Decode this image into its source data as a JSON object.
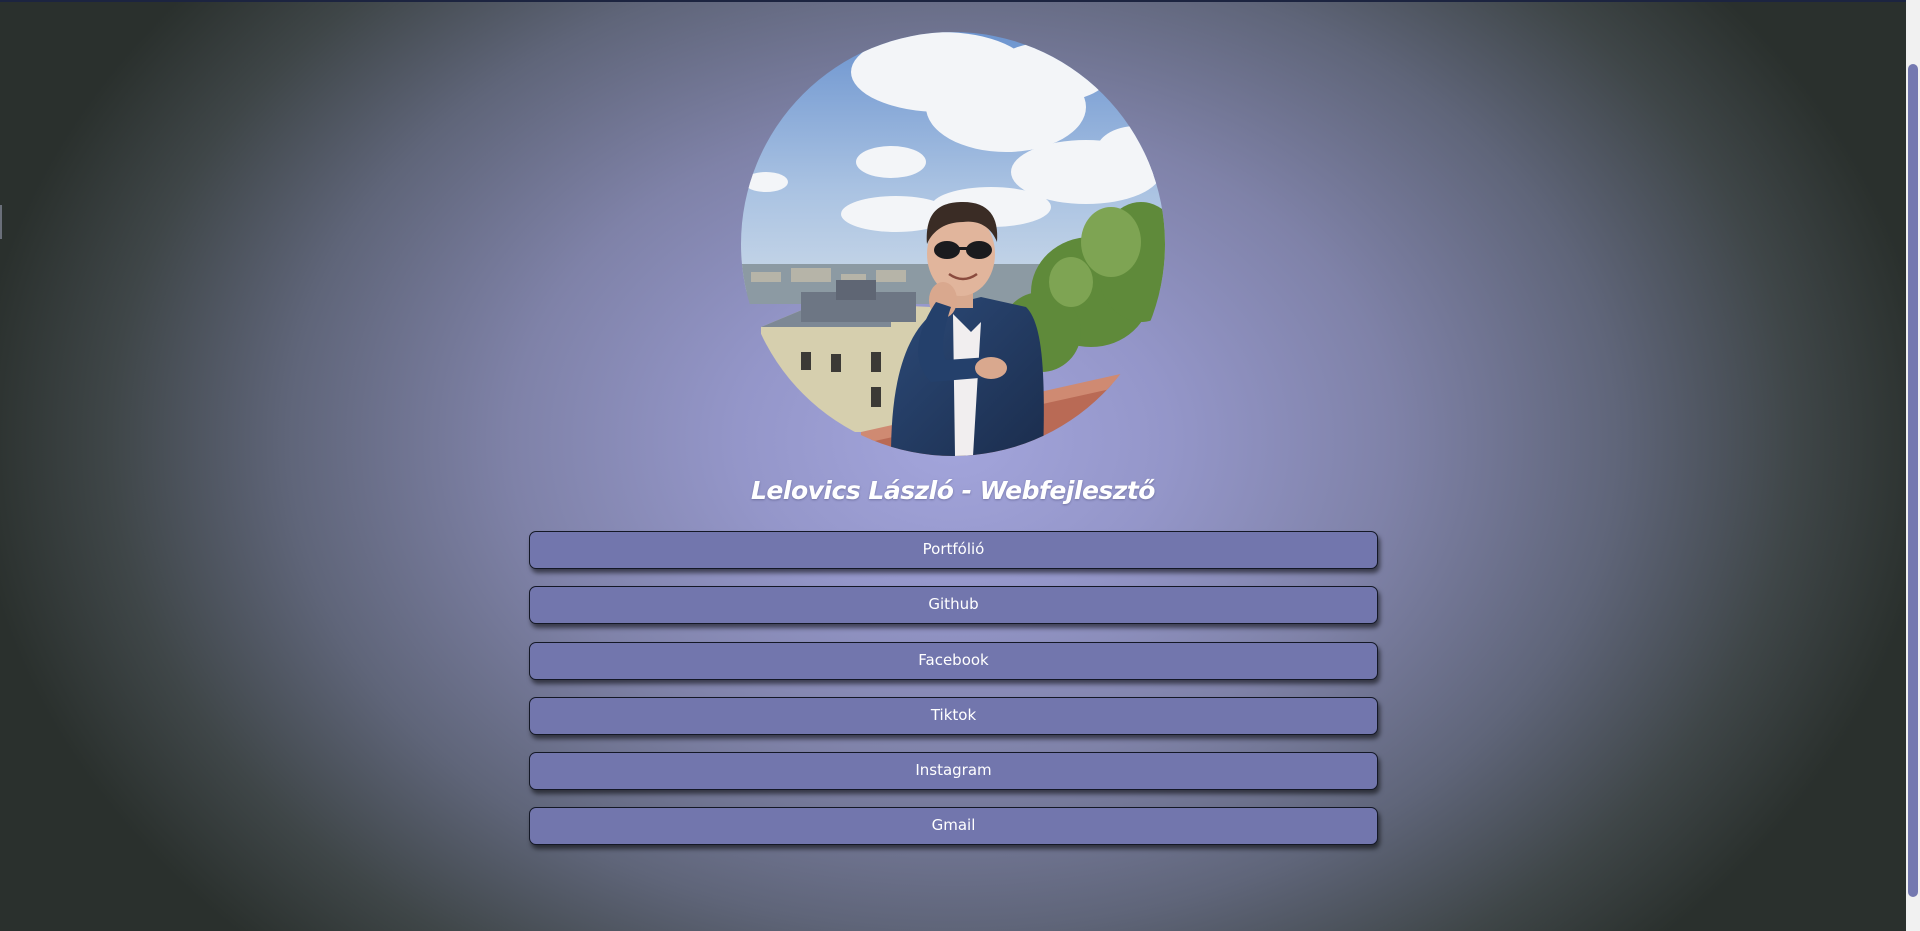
{
  "profile": {
    "photo_alt": "Lelovics László",
    "title": "Lelovics László - Webfejlesztő"
  },
  "links": [
    {
      "label": "Portfólió"
    },
    {
      "label": "Github"
    },
    {
      "label": "Facebook"
    },
    {
      "label": "Tiktok"
    },
    {
      "label": "Instagram"
    },
    {
      "label": "Gmail"
    }
  ],
  "colors": {
    "button": "#7276ad",
    "button_border": "#141826",
    "background_center": "#a3a5dc",
    "background_edge": "#2a302d",
    "scroll_thumb": "#7478b0"
  }
}
